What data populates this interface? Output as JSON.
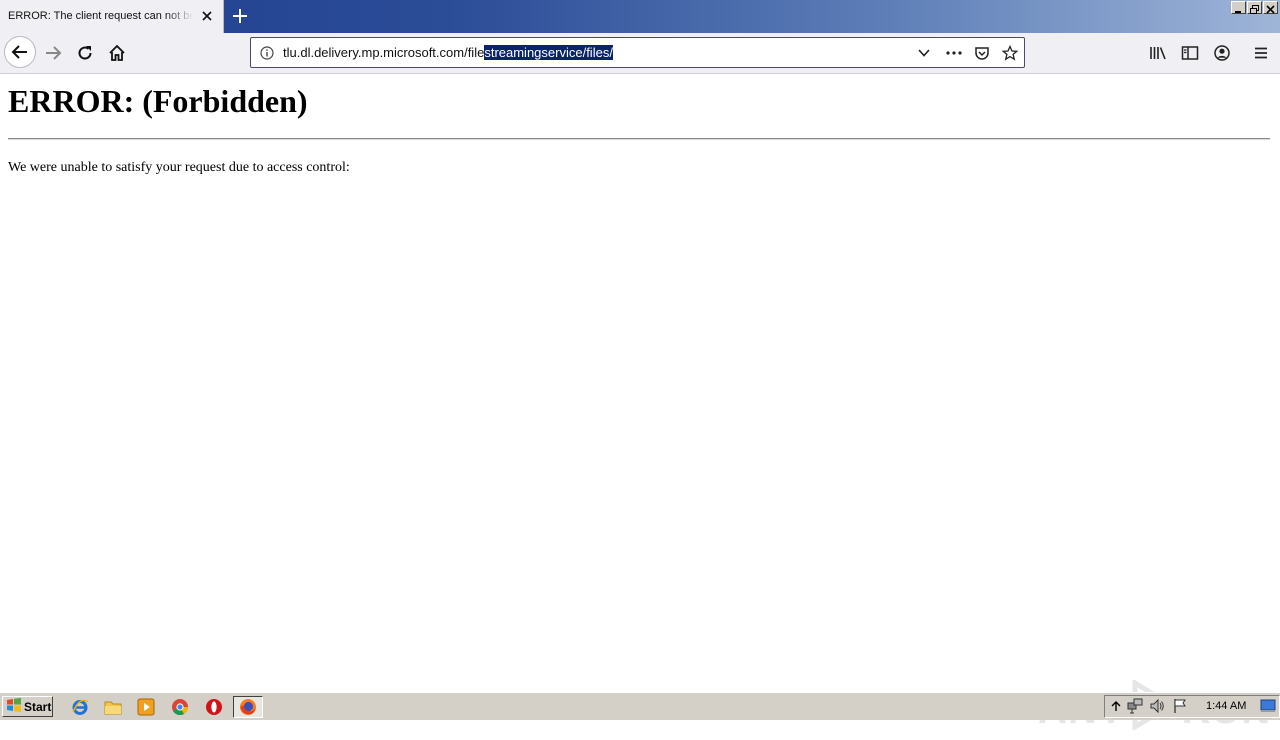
{
  "tab": {
    "title": "ERROR: The client request can not be satisfied",
    "close": "close-icon"
  },
  "toolbar": {
    "url_plain": "tlu.dl.delivery.mp.microsoft.com/file",
    "url_selected": "streamingservice/files/",
    "icons": [
      "back-icon",
      "forward-icon",
      "reload-icon",
      "home-icon",
      "info-icon",
      "dropdown-icon",
      "more-icon",
      "pocket-icon",
      "bookmark-star-icon",
      "library-icon",
      "sidebar-icon",
      "account-icon",
      "menu-icon"
    ]
  },
  "page": {
    "heading": "ERROR: (Forbidden)",
    "message": "We were unable to satisfy your request due to access control:"
  },
  "watermark": {
    "left": "ANY",
    "right": "RUN"
  },
  "taskbar": {
    "start_label": "Start",
    "clock": "1:44 AM",
    "apps": [
      "ie-icon",
      "explorer-icon",
      "media-player-icon",
      "chrome-icon",
      "opera-icon",
      "firefox-icon"
    ]
  },
  "colors": {
    "titlebar": "#2b4c97",
    "selection": "#0a246a",
    "taskbar": "#d4d0c8"
  }
}
